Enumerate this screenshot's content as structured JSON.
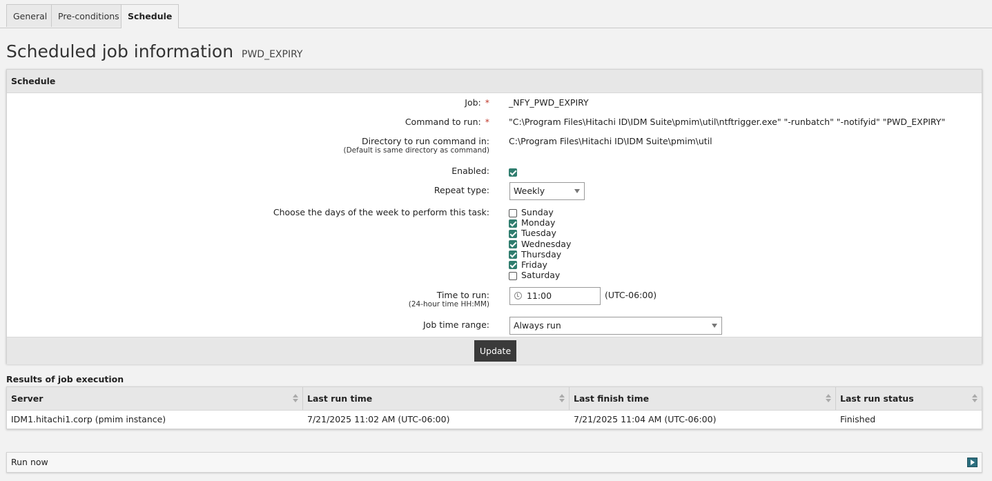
{
  "tabs": [
    {
      "label": "General"
    },
    {
      "label": "Pre-conditions"
    },
    {
      "label": "Schedule"
    }
  ],
  "page": {
    "title": "Scheduled job information",
    "subtitle": "PWD_EXPIRY"
  },
  "schedule": {
    "header": "Schedule",
    "required_marker": "*",
    "job": {
      "label": "Job:",
      "value": "_NFY_PWD_EXPIRY"
    },
    "command": {
      "label": "Command to run:",
      "value": "\"C:\\Program Files\\Hitachi ID\\IDM Suite\\pmim\\util\\ntftrigger.exe\" \"-runbatch\" \"-notifyid\" \"PWD_EXPIRY\""
    },
    "directory": {
      "label": "Directory to run command in:",
      "hint": "(Default is same directory as command)",
      "value": "C:\\Program Files\\Hitachi ID\\IDM Suite\\pmim\\util"
    },
    "enabled": {
      "label": "Enabled:",
      "checked": true
    },
    "repeat_type": {
      "label": "Repeat type:",
      "value": "Weekly"
    },
    "days": {
      "label": "Choose the days of the week to perform this task:",
      "items": [
        {
          "name": "Sunday",
          "checked": false
        },
        {
          "name": "Monday",
          "checked": true
        },
        {
          "name": "Tuesday",
          "checked": true
        },
        {
          "name": "Wednesday",
          "checked": true
        },
        {
          "name": "Thursday",
          "checked": true
        },
        {
          "name": "Friday",
          "checked": true
        },
        {
          "name": "Saturday",
          "checked": false
        }
      ]
    },
    "time": {
      "label": "Time to run:",
      "hint": "(24-hour time HH:MM)",
      "value": "11:00",
      "timezone": "(UTC-06:00)"
    },
    "time_range": {
      "label": "Job time range:",
      "value": "Always run"
    },
    "update_label": "Update"
  },
  "results": {
    "title": "Results of job execution",
    "columns": [
      "Server",
      "Last run time",
      "Last finish time",
      "Last run status"
    ],
    "rows": [
      [
        "IDM1.hitachi1.corp (pmim instance)",
        "7/21/2025 11:02 AM (UTC-06:00)",
        "7/21/2025 11:04 AM (UTC-06:00)",
        "Finished"
      ]
    ]
  },
  "run_now": {
    "label": "Run now",
    "icon": "arrow-right-icon"
  }
}
